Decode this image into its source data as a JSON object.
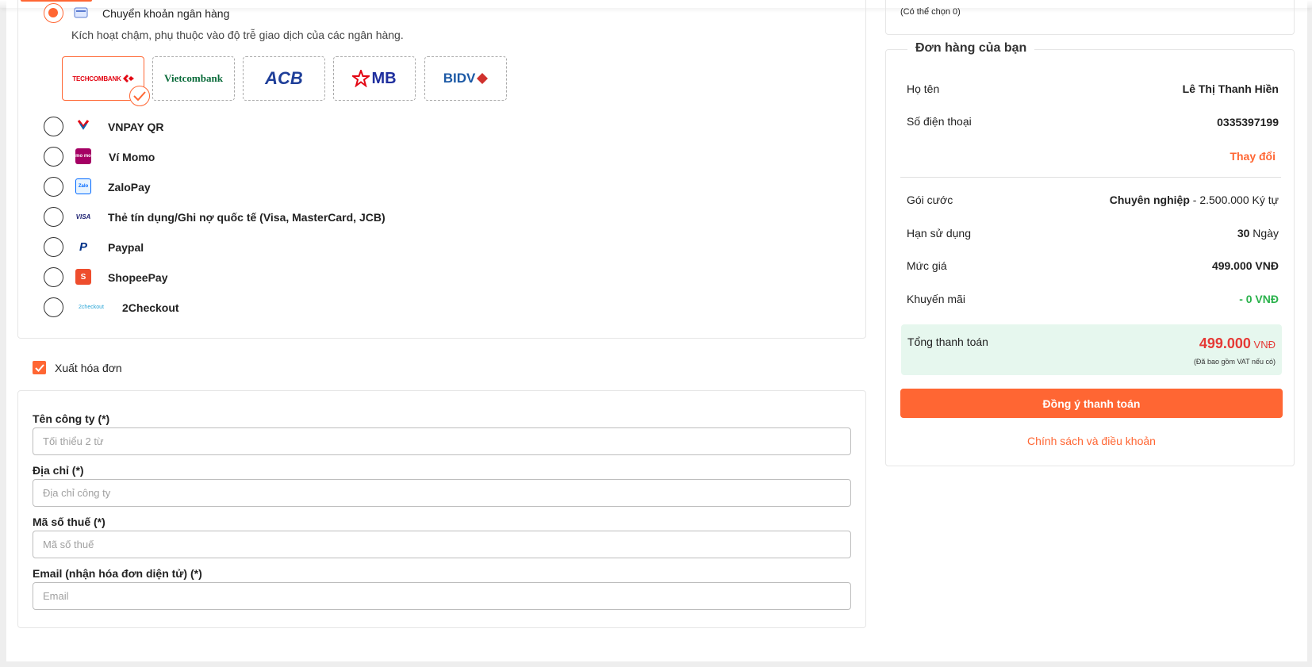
{
  "payment": {
    "bank_transfer_label": "Chuyển khoản ngân hàng",
    "bank_note": "Kích hoạt chậm, phụ thuộc vào độ trễ giao dịch của các ngân hàng.",
    "banks": [
      "TECHCOMBANK",
      "Vietcombank",
      "ACB",
      "MB",
      "BIDV"
    ],
    "selected_bank": "TECHCOMBANK",
    "methods": [
      {
        "label": "VNPAY QR",
        "icon": "vnpay-icon"
      },
      {
        "label": "Ví Momo",
        "icon": "momo-icon",
        "icon_text": "mo mo"
      },
      {
        "label": "ZaloPay",
        "icon": "zalopay-icon",
        "icon_text": "Zalo"
      },
      {
        "label": "Thẻ tín dụng/Ghi nợ quốc tế (Visa, MasterCard, JCB)",
        "icon": "visa-icon",
        "icon_text": "VISA"
      },
      {
        "label": "Paypal",
        "icon": "paypal-icon",
        "icon_text": "P"
      },
      {
        "label": "ShopeePay",
        "icon": "shopeepay-icon",
        "icon_text": "S"
      },
      {
        "label": "2Checkout",
        "icon": "2checkout-icon",
        "icon_text": "2checkout"
      }
    ]
  },
  "invoice": {
    "checkbox_label": "Xuất hóa đơn",
    "checked": true,
    "fields": [
      {
        "label": "Tên công ty (*)",
        "placeholder": "Tối thiểu 2 từ"
      },
      {
        "label": "Địa chỉ (*)",
        "placeholder": "Địa chỉ công ty"
      },
      {
        "label": "Mã số thuế (*)",
        "placeholder": "Mã số thuế"
      },
      {
        "label": "Email (nhận hóa đơn diện tử) (*)",
        "placeholder": "Email"
      }
    ]
  },
  "side": {
    "top_note": "(Có thể chọn 0)"
  },
  "order": {
    "title": "Đơn hàng của bạn",
    "name_label": "Họ tên",
    "name_value": "Lê Thị Thanh Hiền",
    "phone_label": "Số điện thoại",
    "phone_value": "0335397199",
    "change_link": "Thay đổi",
    "plan_label": "Gói cước",
    "plan_name": "Chuyên nghiệp",
    "plan_detail": " - 2.500.000 Ký tự",
    "duration_label": "Hạn sử dụng",
    "duration_value": "30",
    "duration_unit": " Ngày",
    "price_label": "Mức giá",
    "price_value": "499.000 VNĐ",
    "discount_label": "Khuyến mãi",
    "discount_value": "- 0 VNĐ",
    "total_label": "Tổng thanh toán",
    "total_amount": "499.000",
    "total_currency": " VNĐ",
    "vat_note": "(Đã bao gồm VAT nếu có)",
    "pay_button": "Đồng ý thanh toán",
    "policy_link": "Chính sách và điều khoản"
  },
  "colors": {
    "accent": "#ff6633",
    "total_bg": "#e6f7ee",
    "discount": "#2bb24c",
    "total_text": "#e53935"
  }
}
